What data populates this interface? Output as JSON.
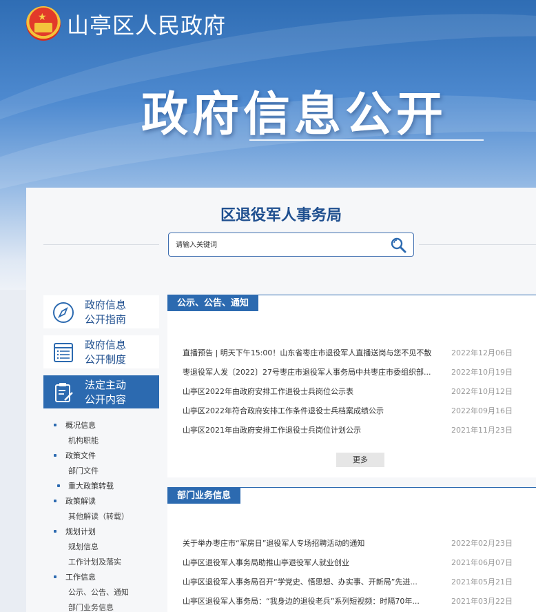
{
  "header": {
    "site_title": "山亭区人民政府",
    "banner_title": "政府信息公开"
  },
  "department": {
    "title": "区退役军人事务局"
  },
  "search": {
    "placeholder": "请输入关键词"
  },
  "sidebar": {
    "cards": [
      {
        "label_line1": "政府信息",
        "label_line2": "公开指南",
        "icon": "compass-icon",
        "active": false
      },
      {
        "label_line1": "政府信息",
        "label_line2": "公开制度",
        "icon": "list-icon",
        "active": false
      },
      {
        "label_line1": "法定主动",
        "label_line2": "公开内容",
        "icon": "clipboard-pen-icon",
        "active": true
      }
    ],
    "items": [
      {
        "label": "概况信息",
        "level": 1
      },
      {
        "label": "机构职能",
        "level": 2
      },
      {
        "label": "政策文件",
        "level": 1
      },
      {
        "label": "部门文件",
        "level": 2
      },
      {
        "label": "重大政策转载",
        "level": 2,
        "bullet": true
      },
      {
        "label": "政策解读",
        "level": 1
      },
      {
        "label": "其他解读（转载）",
        "level": 2
      },
      {
        "label": "规划计划",
        "level": 1
      },
      {
        "label": "规划信息",
        "level": 2
      },
      {
        "label": "工作计划及落实",
        "level": 2
      },
      {
        "label": "工作信息",
        "level": 1
      },
      {
        "label": "公示、公告、通知",
        "level": 2
      },
      {
        "label": "部门业务信息",
        "level": 2
      }
    ]
  },
  "sections": [
    {
      "tab": "公示、公告、通知",
      "more_label": "更多",
      "rows": [
        {
          "title": "直播预告 | 明天下午15:00！山东省枣庄市退役军人直播送岗与您不见不散",
          "date": "2022年12月06日"
        },
        {
          "title": "枣退役军人发〔2022〕27号枣庄市退役军人事务局中共枣庄市委组织部...",
          "date": "2022年10月19日"
        },
        {
          "title": "山亭区2022年由政府安排工作退役士兵岗位公示表",
          "date": "2022年10月12日"
        },
        {
          "title": "山亭区2022年符合政府安排工作条件退役士兵档案成绩公示",
          "date": "2022年09月16日"
        },
        {
          "title": "山亭区2021年由政府安排工作退役士兵岗位计划公示",
          "date": "2021年11月23日"
        }
      ]
    },
    {
      "tab": "部门业务信息",
      "rows": [
        {
          "title": "关于举办枣庄市“军房日”退役军人专场招聘活动的通知",
          "date": "2022年02月23日"
        },
        {
          "title": "山亭区退役军人事务局助推山亭退役军人就业创业",
          "date": "2021年06月07日"
        },
        {
          "title": "山亭区退役军人事务局召开“学党史、悟思想、办实事、开新局”先进...",
          "date": "2021年05月21日"
        },
        {
          "title": "山亭区退役军人事务局：“我身边的退役老兵”系列短视频：时隔70年...",
          "date": "2021年03月22日"
        }
      ]
    }
  ],
  "colors": {
    "primary": "#2c6ab0",
    "title_blue": "#1f4f8f",
    "date_gray": "#999999"
  }
}
